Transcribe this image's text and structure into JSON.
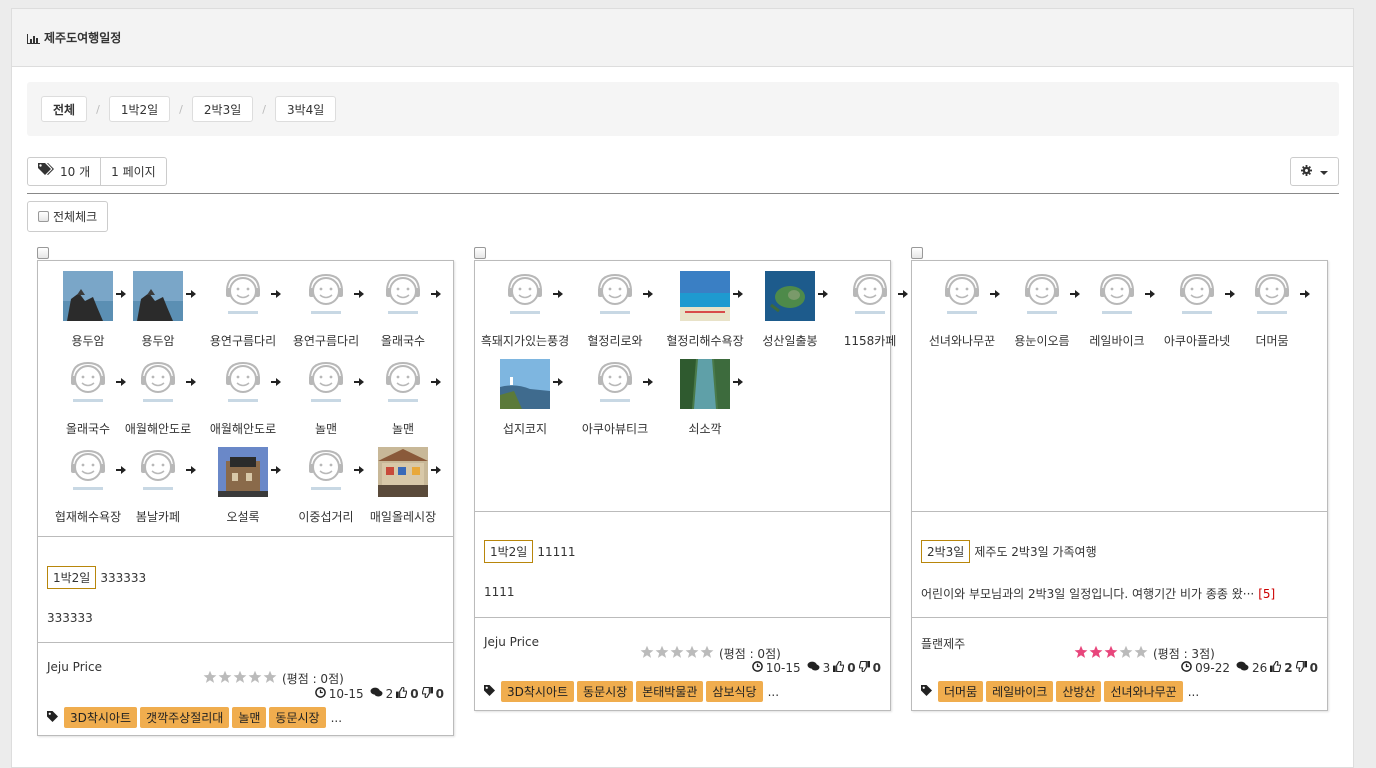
{
  "header": {
    "title": "제주도여행일정",
    "icon": "bar-chart-icon"
  },
  "filters": [
    {
      "label": "전체",
      "active": true
    },
    {
      "label": "1박2일",
      "active": false
    },
    {
      "label": "2박3일",
      "active": false
    },
    {
      "label": "3박4일",
      "active": false
    }
  ],
  "toolbar": {
    "count_label": "10 개",
    "page_label": "1 페이지",
    "settings_icon": "gear-icon",
    "dropdown_icon": "caret-down-icon"
  },
  "check_all_label": "전체체크",
  "colors": {
    "accent": "#f0ad4e",
    "tag_border": "#b8860b",
    "star_on": "#e8467c",
    "star_off": "#bbbbbb",
    "more_count": "#cc0000"
  },
  "cards": [
    {
      "stops": [
        "용두암",
        "용두암",
        "용연구름다리",
        "용연구름다리",
        "올래국수",
        "올래국수",
        "애월해안도로",
        "애월해안도로",
        "놀맨",
        "놀맨",
        "협재해수욕장",
        "봄날카페",
        "오설록",
        "이중섭거리",
        "매일올레시장"
      ],
      "stop_images": [
        "rock",
        "rock",
        "none",
        "none",
        "none",
        "none",
        "none",
        "none",
        "none",
        "none",
        "none",
        "none",
        "building",
        "none",
        "market"
      ],
      "badge": "1박2일",
      "title": "333333",
      "description": "333333",
      "more": "",
      "author": "Jeju Price",
      "rating": 0,
      "rating_label": "(평점 : 0점)",
      "date": "10-15",
      "comments": "2",
      "likes": "0",
      "dislikes": "0",
      "tags": [
        "3D착시아트",
        "갯깍주상절리대",
        "놀맨",
        "동문시장"
      ],
      "ellipsis": "..."
    },
    {
      "stops": [
        "흑돼지가있는풍경",
        "혈정리로와",
        "혈정리해수욕장",
        "성산일출봉",
        "1158카페",
        "섭지코지",
        "아쿠아뷰티크",
        "쇠소깍"
      ],
      "stop_images": [
        "none",
        "none",
        "beach",
        "island",
        "none",
        "cliff",
        "none",
        "river"
      ],
      "badge": "1박2일",
      "title": "11111",
      "description": "1111",
      "more": "",
      "author": "Jeju Price",
      "rating": 0,
      "rating_label": "(평점 : 0점)",
      "date": "10-15",
      "comments": "3",
      "likes": "0",
      "dislikes": "0",
      "tags": [
        "3D착시아트",
        "동문시장",
        "본태박물관",
        "삼보식당"
      ],
      "ellipsis": "..."
    },
    {
      "stops": [
        "선녀와나무꾼",
        "용눈이오름",
        "레일바이크",
        "아쿠아플라넷",
        "더머뭄"
      ],
      "stop_images": [
        "none",
        "none",
        "none",
        "none",
        "none"
      ],
      "badge": "2박3일",
      "title": "제주도 2박3일 가족여행",
      "description": "어린이와 부모님과의 2박3일 일정입니다. 여행기간 비가 종종 왔···",
      "more": "[5]",
      "author": "플랜제주",
      "rating": 3,
      "rating_label": "(평점 : 3점)",
      "date": "09-22",
      "comments": "26",
      "likes": "2",
      "dislikes": "0",
      "tags": [
        "더머뭄",
        "레일바이크",
        "산방산",
        "선녀와나무꾼"
      ],
      "ellipsis": "..."
    }
  ]
}
